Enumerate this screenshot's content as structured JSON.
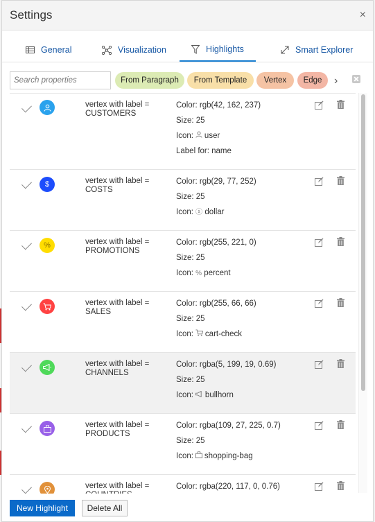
{
  "dialog": {
    "title": "Settings",
    "close_label": "×"
  },
  "tabs": [
    {
      "label": "General",
      "icon": "table-icon"
    },
    {
      "label": "Visualization",
      "icon": "graph-icon"
    },
    {
      "label": "Highlights",
      "icon": "filter-icon",
      "active": true
    },
    {
      "label": "Smart Explorer",
      "icon": "expand-icon"
    }
  ],
  "toolbar": {
    "search_placeholder": "Search properties",
    "chips": [
      {
        "label": "From Paragraph",
        "color": "#dcebb4"
      },
      {
        "label": "From Template",
        "color": "#f8dfa8"
      },
      {
        "label": "Vertex",
        "color": "#f5c3a4"
      },
      {
        "label": "Edge",
        "color": "#f3b6a5"
      }
    ]
  },
  "highlights": [
    {
      "label": "vertex with label = CUSTOMERS",
      "color_text": "Color: rgb(42, 162, 237)",
      "color": "#2aa2ed",
      "size_text": "Size: 25",
      "icon_prefix": "Icon:",
      "icon_name": "user",
      "glyph": "user-icon",
      "extra": "Label for: name"
    },
    {
      "label": "vertex with label = COSTS",
      "color_text": "Color: rgb(29, 77, 252)",
      "color": "#1d4dfc",
      "size_text": "Size: 25",
      "icon_prefix": "Icon:",
      "icon_name": "dollar",
      "glyph": "dollar-icon"
    },
    {
      "label": "vertex with label = PROMOTIONS",
      "color_text": "Color: rgb(255, 221, 0)",
      "color": "#ffdd00",
      "size_text": "Size: 25",
      "icon_prefix": "Icon:",
      "icon_name": "percent",
      "glyph": "percent-icon"
    },
    {
      "label": "vertex with label = SALES",
      "color_text": "Color: rgb(255, 66, 66)",
      "color": "#ff4242",
      "size_text": "Size: 25",
      "icon_prefix": "Icon:",
      "icon_name": "cart-check",
      "glyph": "cart-check-icon"
    },
    {
      "label": "vertex with label = CHANNELS",
      "color_text": "Color: rgba(5, 199, 19, 0.69)",
      "color": "#4fd95a",
      "size_text": "Size: 25",
      "icon_prefix": "Icon:",
      "icon_name": "bullhorn",
      "glyph": "bullhorn-icon",
      "selected": true
    },
    {
      "label": "vertex with label = PRODUCTS",
      "color_text": "Color: rgba(109, 27, 225, 0.7)",
      "color": "#9860e8",
      "size_text": "Size: 25",
      "icon_prefix": "Icon:",
      "icon_name": "shopping-bag",
      "glyph": "shopping-bag-icon"
    },
    {
      "label": "vertex with label = COUNTRIES",
      "color_text": "Color: rgba(220, 117, 0, 0.76)",
      "color": "#e1913a",
      "size_text": "",
      "icon_prefix": "",
      "icon_name": "",
      "glyph": "map-marker-icon"
    }
  ],
  "footer": {
    "new_label": "New Highlight",
    "delete_label": "Delete All"
  }
}
